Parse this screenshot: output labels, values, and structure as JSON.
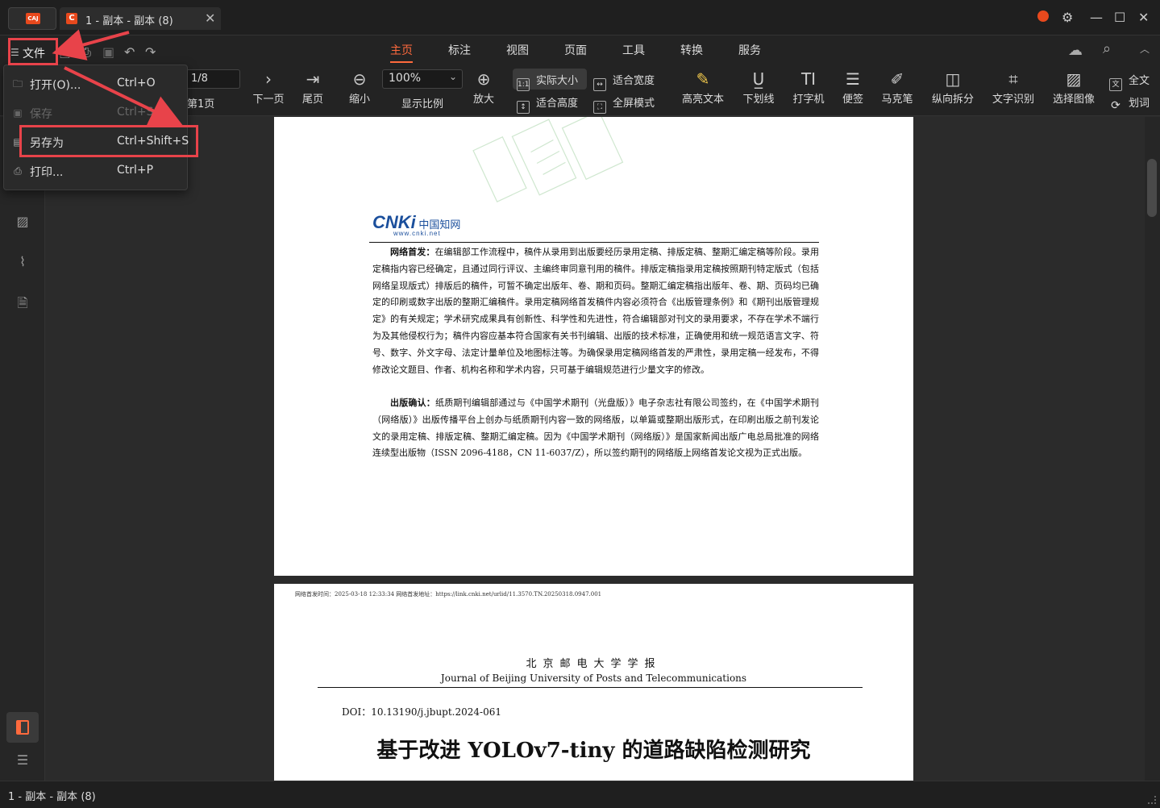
{
  "window": {
    "app_badge": "CAJ",
    "tab_title": "1 - 副本 - 副本 (8)",
    "tab_close": "✕",
    "minimize": "—",
    "maximize": "☐",
    "close": "✕"
  },
  "file_button": {
    "label": "文件",
    "icon": "☰"
  },
  "menu_tabs": [
    "主页",
    "标注",
    "视图",
    "页面",
    "工具",
    "转换",
    "服务"
  ],
  "toolbar": {
    "page_value": "1/8",
    "first_page": "第1页",
    "next_page": "下一页",
    "last_page": "尾页",
    "zoom_out": "缩小",
    "zoom_value": "100%",
    "zoom_label": "显示比例",
    "zoom_in": "放大",
    "actual_size": "实际大小",
    "fit_width": "适合宽度",
    "fit_height": "适合高度",
    "fullscreen": "全屏模式",
    "highlight": "高亮文本",
    "underline": "下划线",
    "typewriter": "打字机",
    "note": "便签",
    "marker": "马克笔",
    "split": "纵向拆分",
    "ocr": "文字识别",
    "select_image": "选择图像",
    "fulltext": "全文",
    "word_select": "划词"
  },
  "file_menu": {
    "items": [
      {
        "label": "打开(O)...",
        "shortcut": "Ctrl+O",
        "enabled": true
      },
      {
        "label": "保存",
        "shortcut": "Ctrl+S",
        "enabled": false
      },
      {
        "label": "另存为",
        "shortcut": "Ctrl+Shift+S",
        "enabled": true
      },
      {
        "label": "打印...",
        "shortcut": "Ctrl+P",
        "enabled": true
      }
    ]
  },
  "page1": {
    "logo_mark": "CNKi",
    "logo_cn": "中国知网",
    "logo_url": "www.cnki.net",
    "para1_bold": "网络首发：",
    "para1": "在编辑部工作流程中，稿件从录用到出版要经历录用定稿、排版定稿、整期汇编定稿等阶段。录用定稿指内容已经确定，且通过同行评议、主编终审同意刊用的稿件。排版定稿指录用定稿按照期刊特定版式（包括网络呈现版式）排版后的稿件，可暂不确定出版年、卷、期和页码。整期汇编定稿指出版年、卷、期、页码均已确定的印刷或数字出版的整期汇编稿件。录用定稿网络首发稿件内容必须符合《出版管理条例》和《期刊出版管理规定》的有关规定；学术研究成果具有创新性、科学性和先进性，符合编辑部对刊文的录用要求，不存在学术不端行为及其他侵权行为；稿件内容应基本符合国家有关书刊编辑、出版的技术标准，正确使用和统一规范语言文字、符号、数字、外文字母、法定计量单位及地图标注等。为确保录用定稿网络首发的严肃性，录用定稿一经发布，不得修改论文题目、作者、机构名称和学术内容，只可基于编辑规范进行少量文字的修改。",
    "para2_bold": "出版确认：",
    "para2": "纸质期刊编辑部通过与《中国学术期刊（光盘版）》电子杂志社有限公司签约，在《中国学术期刊（网络版）》出版传播平台上创办与纸质期刊内容一致的网络版，以单篇或整期出版形式，在印刷出版之前刊发论文的录用定稿、排版定稿、整期汇编定稿。因为《中国学术期刊（网络版）》是国家新闻出版广电总局批准的网络连续型出版物（ISSN 2096-4188，CN 11-6037/Z），所以签约期刊的网络版上网络首发论文视为正式出版。"
  },
  "page2": {
    "header": "网络首发时间：2025-03-18 12:33:34     网络首发地址：https://link.cnki.net/urlid/11.3570.TN.20250318.0947.001",
    "journal_cn": "北京邮电大学学报",
    "journal_en": "Journal of Beijing University of Posts and Telecommunications",
    "doi": "DOI：10.13190/j.jbupt.2024-061",
    "title": "基于改进 YOLOv7-tiny 的道路缺陷检测研究"
  },
  "status": {
    "text": "1 - 副本 - 副本 (8)"
  },
  "colors": {
    "accent": "#ff6a3d",
    "annotation": "#e8434a",
    "background": "#2b2b2b"
  }
}
